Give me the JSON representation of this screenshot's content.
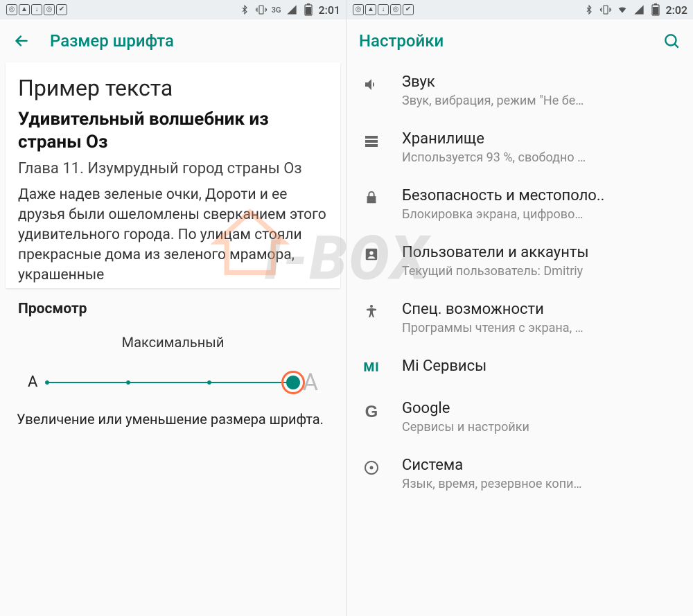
{
  "left": {
    "status": {
      "time": "2:01",
      "network": "3G"
    },
    "toolbar_title": "Размер шрифта",
    "sample_label": "Пример текста",
    "sample_title": "Удивительный волшебник из страны Оз",
    "sample_chapter": "Глава 11. Изумрудный город страны Оз",
    "sample_body": "Даже надев зеленые очки, Дороти и ее друзья были ошеломлены сверканием этого удивительного города. По улицам стояли прекрасные дома из зеленого мрамора, украшенные",
    "preview_label": "Просмотр",
    "slider_label": "Максимальный",
    "small_a": "A",
    "large_a": "A",
    "slider_desc": "Увеличение или уменьшение размера шрифта."
  },
  "right": {
    "status": {
      "time": "2:02"
    },
    "toolbar_title": "Настройки",
    "items": [
      {
        "icon": "sound",
        "title": "Звук",
        "sub": "Звук, вибрация, режим \"Не бе…"
      },
      {
        "icon": "storage",
        "title": "Хранилище",
        "sub": "Используется 93 %, свободно …"
      },
      {
        "icon": "lock",
        "title": "Безопасность и местополо..",
        "sub": "Блокировка экрана, цифрово…"
      },
      {
        "icon": "user",
        "title": "Пользователи и аккаунты",
        "sub": "Текущий пользователь: Dmitriy"
      },
      {
        "icon": "access",
        "title": "Спец. возможности",
        "sub": "Программы чтения с экрана, …"
      },
      {
        "icon": "mi",
        "title": "Mi Сервисы",
        "sub": ""
      },
      {
        "icon": "google",
        "title": "Google",
        "sub": "Сервисы и настройки"
      },
      {
        "icon": "system",
        "title": "Система",
        "sub": "Язык, время, резервное копи…"
      }
    ]
  },
  "watermark": "I-BOX"
}
